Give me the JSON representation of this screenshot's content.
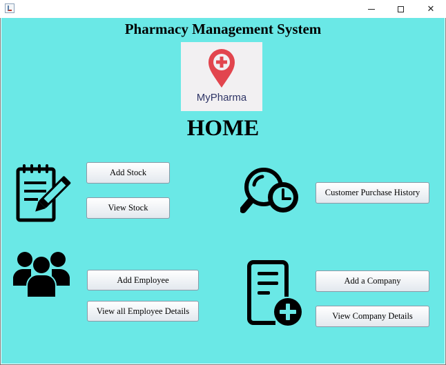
{
  "window": {
    "minimize_glyph": "",
    "maximize_glyph": "",
    "close_glyph": "✕"
  },
  "header": {
    "title": "Pharmacy Management System",
    "logo_text": "MyPharma",
    "home_label": "HOME"
  },
  "actions": {
    "add_stock": "Add Stock",
    "view_stock": "View Stock",
    "customer_purchase_history": "Customer Purchase History",
    "add_employee": "Add Employee",
    "view_all_employee_details": "View all Employee Details",
    "add_company": "Add a Company",
    "view_company_details": "View Company Details"
  },
  "icons": {
    "app": "java-app-icon",
    "logo": "pharmacy-location-pin-icon",
    "stock": "notepad-pencil-icon",
    "history": "search-clock-icon",
    "employees": "group-people-icon",
    "company": "document-add-icon"
  },
  "colors": {
    "background": "#6ae8e6",
    "logo_pin": "#e2454e",
    "logo_text": "#2f3566"
  }
}
